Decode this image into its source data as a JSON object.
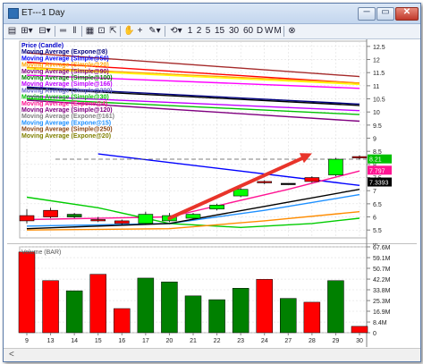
{
  "window": {
    "title": "ET---1 Day",
    "controls": {
      "minimize": "─",
      "maximize": "▭",
      "close": "✕"
    }
  },
  "toolbar": {
    "items": [
      {
        "name": "print-icon",
        "glyph": "▤"
      },
      {
        "name": "bar-style-dropdown",
        "glyph": "⊞▾"
      },
      {
        "name": "price-style-dropdown",
        "glyph": "⊟▾"
      },
      {
        "name": "double-line-icon",
        "glyph": "═"
      },
      {
        "name": "pipe-icon",
        "glyph": "‖"
      },
      {
        "name": "grid-icon",
        "glyph": "▦"
      },
      {
        "name": "zoom-box-icon",
        "glyph": "⊡"
      },
      {
        "name": "cursor-icon",
        "glyph": "⇱"
      },
      {
        "name": "hand-icon",
        "glyph": "✋"
      },
      {
        "name": "crosshair-icon",
        "glyph": "+"
      },
      {
        "name": "draw-dropdown",
        "glyph": "✎▾"
      },
      {
        "name": "sync-dropdown",
        "glyph": "⟲▾"
      }
    ],
    "periods": [
      "1",
      "2",
      "5",
      "15",
      "30",
      "60",
      "D",
      "W",
      "M"
    ],
    "close_icon": "⊗"
  },
  "chart_data": [
    {
      "type": "candlestick",
      "title": "ET---1 Day",
      "x_categories": [
        "9",
        "13",
        "14",
        "15",
        "16",
        "17",
        "20",
        "21",
        "22",
        "23",
        "24",
        "27",
        "28",
        "29",
        "30"
      ],
      "y_ticks": [
        "12.5",
        "12",
        "11.5",
        "11",
        "10.5",
        "10",
        "9.5",
        "9",
        "8.5",
        "8",
        "7.5",
        "7",
        "6.5",
        "6",
        "5.5"
      ],
      "ylim": [
        5.2,
        12.7
      ],
      "candles": [
        {
          "x": "9",
          "open": 5.85,
          "close": 6.05,
          "high": 6.3,
          "low": 5.75,
          "color": "#ff0000"
        },
        {
          "x": "13",
          "open": 6.0,
          "close": 6.25,
          "high": 6.35,
          "low": 5.95,
          "color": "#ff0000"
        },
        {
          "x": "14",
          "open": 6.0,
          "close": 6.1,
          "high": 6.15,
          "low": 5.95,
          "color": "#008000"
        },
        {
          "x": "15",
          "open": 5.85,
          "close": 5.9,
          "high": 6.0,
          "low": 5.8,
          "color": "#ff0000"
        },
        {
          "x": "16",
          "open": 5.75,
          "close": 5.85,
          "high": 5.9,
          "low": 5.7,
          "color": "#ff0000"
        },
        {
          "x": "17",
          "open": 5.75,
          "close": 6.1,
          "high": 6.2,
          "low": 5.7,
          "color": "#00ff00"
        },
        {
          "x": "20",
          "open": 5.85,
          "close": 6.05,
          "high": 6.15,
          "low": 5.8,
          "color": "#00ff00"
        },
        {
          "x": "21",
          "open": 5.95,
          "close": 6.1,
          "high": 6.15,
          "low": 5.9,
          "color": "#00ff00"
        },
        {
          "x": "22",
          "open": 6.3,
          "close": 6.45,
          "high": 6.5,
          "low": 6.25,
          "color": "#00ff00"
        },
        {
          "x": "23",
          "open": 6.8,
          "close": 7.05,
          "high": 7.1,
          "low": 6.75,
          "color": "#00ff00"
        },
        {
          "x": "24",
          "open": 7.3,
          "close": 7.35,
          "high": 7.4,
          "low": 7.25,
          "color": "#ff0000"
        },
        {
          "x": "27",
          "open": 7.28,
          "close": 7.28,
          "high": 7.28,
          "low": 7.28,
          "color": "#000000"
        },
        {
          "x": "28",
          "open": 7.35,
          "close": 7.5,
          "high": 7.55,
          "low": 7.3,
          "color": "#ff0000"
        },
        {
          "x": "29",
          "open": 7.6,
          "close": 8.2,
          "high": 8.25,
          "low": 7.55,
          "color": "#00ff00"
        },
        {
          "x": "30",
          "open": 8.25,
          "close": 8.3,
          "high": 8.35,
          "low": 8.2,
          "color": "#ff0000"
        }
      ],
      "legend": [
        {
          "label": "Price (Candle)",
          "color": "#0000cc"
        },
        {
          "label": "Moving Average (Expone@8)",
          "color": "#000080"
        },
        {
          "label": "Moving Average (Simple@50)",
          "color": "#0000ff"
        },
        {
          "label": "Moving Average (Simple@20)",
          "color": "#ffa500"
        },
        {
          "label": "Moving Average (Simple@90)",
          "color": "#800080"
        },
        {
          "label": "Moving Average (Simple@100)",
          "color": "#008000"
        },
        {
          "label": "Moving Average (Simple@166)",
          "color": "#c000ff"
        },
        {
          "label": "Moving Average (Simple@200)",
          "color": "#6666cc"
        },
        {
          "label": "Moving Average (Simple@30)",
          "color": "#00c000"
        },
        {
          "label": "Moving Average (Expone@4)",
          "color": "#ff1493"
        },
        {
          "label": "Moving Average (Simple@120)",
          "color": "#800080"
        },
        {
          "label": "Moving Average (Expone@161)",
          "color": "#808080"
        },
        {
          "label": "Moving Average (Expone@15)",
          "color": "#1e90ff"
        },
        {
          "label": "Moving Average (Simple@250)",
          "color": "#8b4513"
        },
        {
          "label": "Moving Average (Expone@20)",
          "color": "#808000"
        }
      ],
      "ma_lines": [
        {
          "color": "#a52a2a",
          "points": [
            [
              0,
              12.25
            ],
            [
              14,
              11.35
            ]
          ]
        },
        {
          "color": "#ff0000",
          "points": [
            [
              0,
              11.9
            ],
            [
              14,
              11.1
            ]
          ]
        },
        {
          "color": "#ffa500",
          "points": [
            [
              0,
              11.7
            ],
            [
              14,
              11.1
            ]
          ]
        },
        {
          "color": "#ffff00",
          "points": [
            [
              0,
              11.65
            ],
            [
              14,
              11.05
            ]
          ]
        },
        {
          "color": "#ff00ff",
          "points": [
            [
              0,
              11.4
            ],
            [
              14,
              10.9
            ]
          ]
        },
        {
          "color": "#000080",
          "points": [
            [
              0,
              10.95
            ],
            [
              14,
              10.3
            ]
          ]
        },
        {
          "color": "#000000",
          "points": [
            [
              0,
              10.9
            ],
            [
              14,
              10.25
            ]
          ]
        },
        {
          "color": "#c000ff",
          "points": [
            [
              0,
              10.6
            ],
            [
              14,
              10.05
            ]
          ]
        },
        {
          "color": "#00c000",
          "points": [
            [
              0,
              10.5
            ],
            [
              14,
              9.9
            ]
          ]
        },
        {
          "color": "#800080",
          "points": [
            [
              0,
              10.45
            ],
            [
              14,
              9.65
            ]
          ]
        },
        {
          "color": "#0000ff",
          "points": [
            [
              3,
              8.4
            ],
            [
              14,
              7.2
            ]
          ]
        },
        {
          "color": "#00cc00",
          "points": [
            [
              0,
              6.75
            ],
            [
              3,
              6.35
            ],
            [
              6,
              5.75
            ],
            [
              9,
              5.6
            ],
            [
              12,
              5.75
            ],
            [
              14,
              5.95
            ]
          ]
        },
        {
          "color": "#ff8c00",
          "points": [
            [
              0,
              5.5
            ],
            [
              6,
              5.55
            ],
            [
              10,
              5.85
            ],
            [
              14,
              6.2
            ]
          ]
        },
        {
          "color": "#1e90ff",
          "points": [
            [
              0,
              5.65
            ],
            [
              6,
              5.75
            ],
            [
              10,
              6.25
            ],
            [
              14,
              6.85
            ]
          ]
        },
        {
          "color": "#000000",
          "points": [
            [
              0,
              5.55
            ],
            [
              6,
              5.75
            ],
            [
              10,
              6.4
            ],
            [
              14,
              7.05
            ]
          ]
        },
        {
          "color": "#ff1493",
          "points": [
            [
              0,
              5.9
            ],
            [
              6,
              6.0
            ],
            [
              11,
              7.05
            ],
            [
              14,
              7.75
            ]
          ]
        }
      ],
      "dashed_level": 8.2,
      "trend_arrow": {
        "from": [
          6,
          5.95
        ],
        "to": [
          12,
          8.42
        ],
        "color": "#e8342a"
      },
      "price_labels": [
        {
          "text": "8.21",
          "value": 8.21,
          "color": "#00c000"
        },
        {
          "text": "7.797",
          "value": 7.78,
          "color": "#ff1493"
        },
        {
          "text": "7.3393",
          "value": 7.33,
          "color": "#000000"
        }
      ]
    },
    {
      "type": "bar",
      "title": "Volume (BAR)",
      "categories": [
        "9",
        "13",
        "14",
        "15",
        "16",
        "17",
        "20",
        "21",
        "22",
        "23",
        "24",
        "27",
        "28",
        "29",
        "30"
      ],
      "values": [
        63.5,
        41,
        33,
        46,
        19,
        43,
        40,
        29,
        26,
        35,
        42,
        27,
        24,
        41,
        5
      ],
      "colors": [
        "#ff0000",
        "#ff0000",
        "#008000",
        "#ff0000",
        "#ff0000",
        "#008000",
        "#008000",
        "#008000",
        "#008000",
        "#008000",
        "#ff0000",
        "#008000",
        "#ff0000",
        "#008000",
        "#ff0000"
      ],
      "y_ticks": [
        "67.6M",
        "59.1M",
        "50.7M",
        "42.2M",
        "33.8M",
        "25.3M",
        "16.9M",
        "8.4M",
        "0"
      ],
      "ylim": [
        0,
        67.6
      ],
      "ylabel": "M"
    }
  ],
  "status": {
    "left": "<"
  },
  "colors": {
    "window_border": "#5a7aa8",
    "grid": "#d9d9d9",
    "titlebar": "#c3d6ee"
  }
}
